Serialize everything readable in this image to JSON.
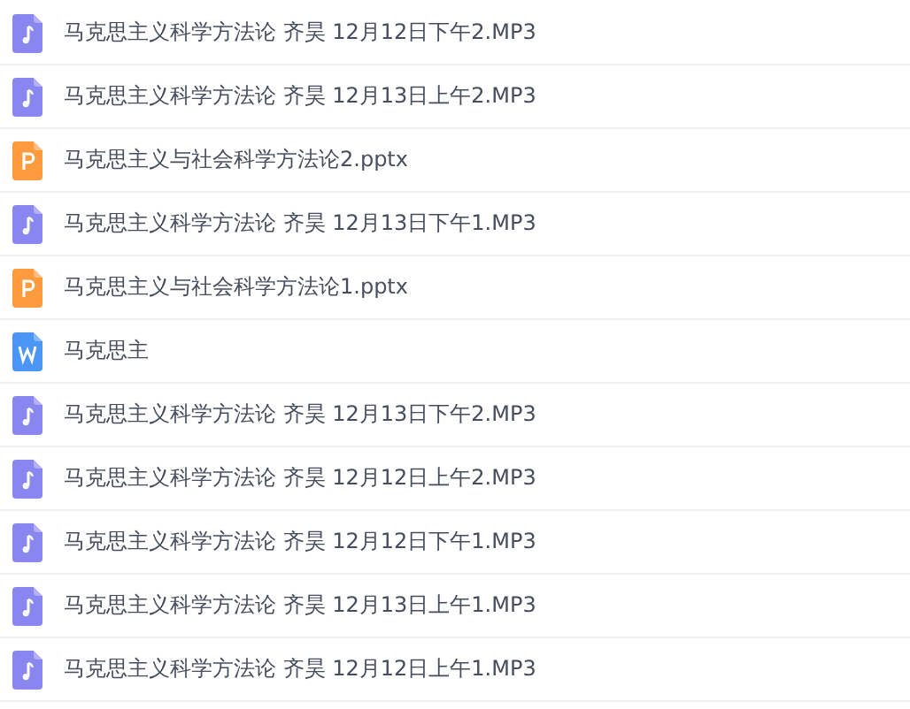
{
  "files": [
    {
      "kind": "audio",
      "name": "马克思主义科学方法论 齐昊 12月12日下午2.MP3"
    },
    {
      "kind": "audio",
      "name": "马克思主义科学方法论 齐昊 12月13日上午2.MP3"
    },
    {
      "kind": "slides",
      "name": "马克思主义与社会科学方法论2.pptx"
    },
    {
      "kind": "audio",
      "name": "马克思主义科学方法论 齐昊 12月13日下午1.MP3"
    },
    {
      "kind": "slides",
      "name": "马克思主义与社会科学方法论1.pptx"
    },
    {
      "kind": "document",
      "name": "马克思主"
    },
    {
      "kind": "audio",
      "name": "马克思主义科学方法论 齐昊 12月13日下午2.MP3"
    },
    {
      "kind": "audio",
      "name": "马克思主义科学方法论 齐昊 12月12日上午2.MP3"
    },
    {
      "kind": "audio",
      "name": "马克思主义科学方法论 齐昊 12月12日下午1.MP3"
    },
    {
      "kind": "audio",
      "name": "马克思主义科学方法论 齐昊 12月13日上午1.MP3"
    },
    {
      "kind": "audio",
      "name": "马克思主义科学方法论 齐昊 12月12日上午1.MP3"
    }
  ]
}
